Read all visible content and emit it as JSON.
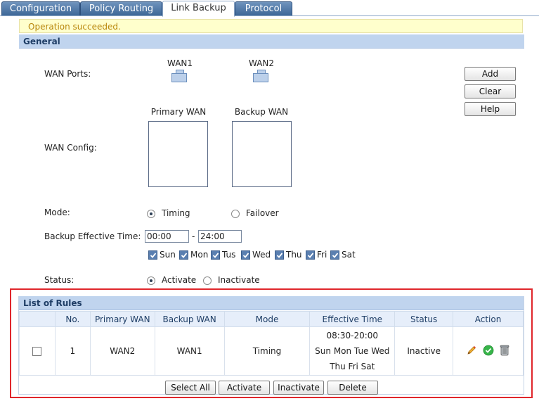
{
  "tabs": [
    "Configuration",
    "Policy Routing",
    "Link Backup",
    "Protocol"
  ],
  "active_tab": "Link Backup",
  "notice": "Operation succeeded.",
  "general": {
    "title": "General",
    "wan_ports_label": "WAN Ports:",
    "ports": [
      "WAN1",
      "WAN2"
    ],
    "wan_config_label": "WAN Config:",
    "primary_wan_label": "Primary WAN",
    "backup_wan_label": "Backup WAN",
    "buttons": {
      "add": "Add",
      "clear": "Clear",
      "help": "Help"
    },
    "mode_label": "Mode:",
    "mode_options": [
      "Timing",
      "Failover"
    ],
    "mode_selected": "Timing",
    "backup_time_label": "Backup Effective Time:",
    "time_start": "00:00",
    "time_sep": "-",
    "time_end": "24:00",
    "days": [
      "Sun",
      "Mon",
      "Tus",
      "Wed",
      "Thu",
      "Fri",
      "Sat"
    ],
    "status_label": "Status:",
    "status_options": [
      "Activate",
      "Inactivate"
    ],
    "status_selected": "Activate"
  },
  "rules": {
    "title": "List of Rules",
    "columns": [
      "",
      "No.",
      "Primary WAN",
      "Backup WAN",
      "Mode",
      "Effective Time",
      "Status",
      "Action"
    ],
    "rows": [
      {
        "no": "1",
        "primary": "WAN2",
        "backup": "WAN1",
        "mode": "Timing",
        "effective_time": [
          "08:30-20:00",
          "Sun Mon Tue Wed",
          "Thu Fri Sat"
        ],
        "status": "Inactive"
      }
    ],
    "buttons": {
      "select_all": "Select All",
      "activate": "Activate",
      "inactivate": "Inactivate",
      "delete": "Delete"
    }
  },
  "icons": [
    "edit-pencil-icon",
    "activate-check-icon",
    "delete-trash-icon"
  ],
  "colors": {
    "tab_bg": "#3d6797",
    "section_head": "#c0d4ee",
    "notice_bg": "#ffffcc",
    "notice_text": "#b8860b",
    "highlight_frame": "#e0262b"
  }
}
